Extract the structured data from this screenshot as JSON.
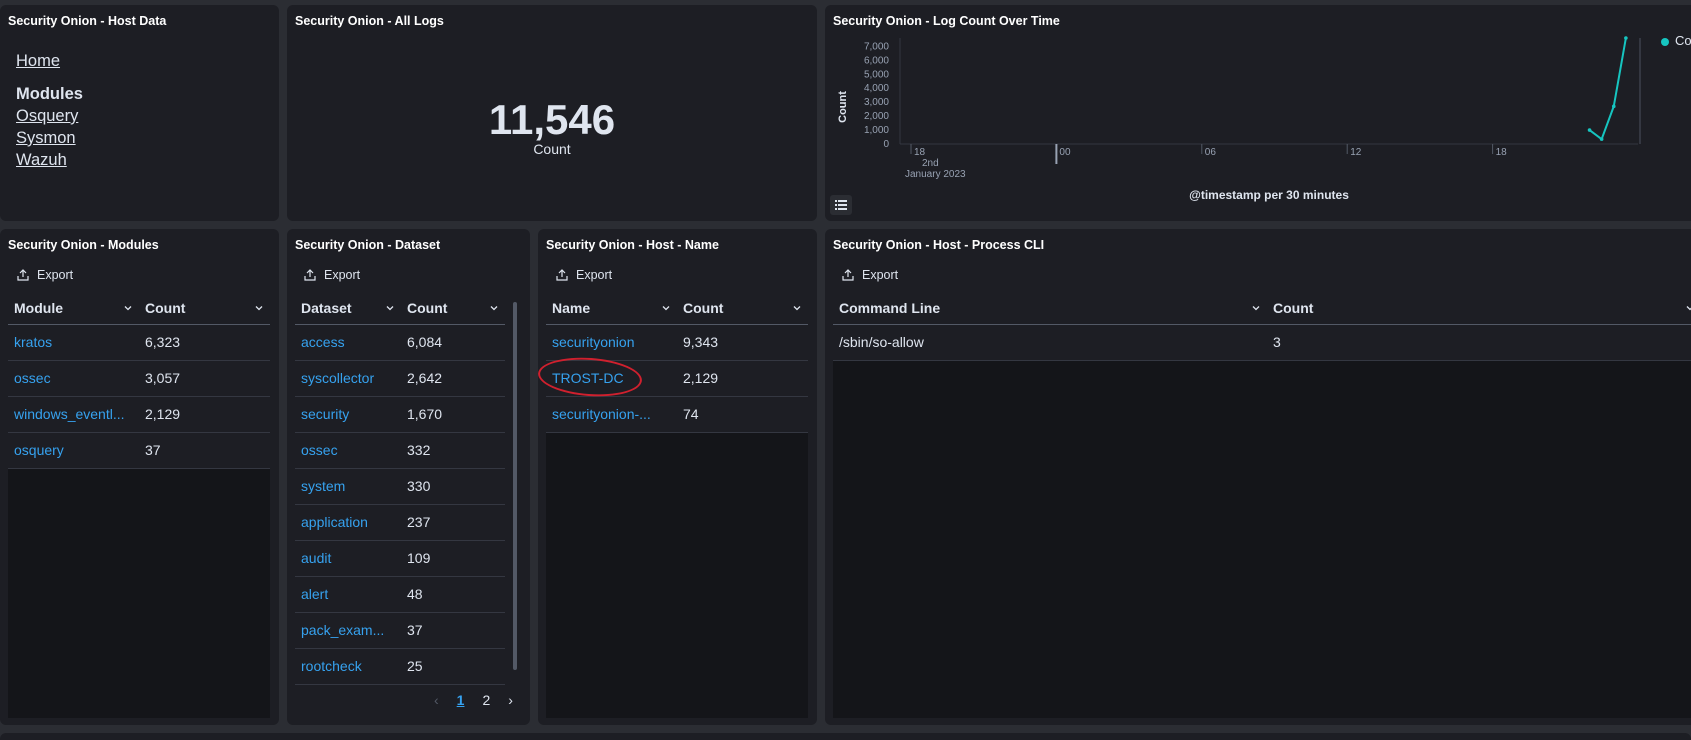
{
  "panels": {
    "host_data": {
      "title": "Security Onion - Host Data",
      "home": "Home",
      "modules_heading": "Modules",
      "links": [
        "Osquery",
        "Sysmon",
        "Wazuh"
      ]
    },
    "all_logs": {
      "title": "Security Onion - All Logs",
      "value": "11,546",
      "label": "Count"
    },
    "log_count": {
      "title": "Security Onion - Log Count Over Time",
      "legend": "Co",
      "ylabel": "Count",
      "xlabel": "@timestamp per 30 minutes",
      "x_sub1": "2nd",
      "x_sub2": "January 2023"
    },
    "modules": {
      "title": "Security Onion - Modules",
      "export": "Export",
      "headers": [
        "Module",
        "Count"
      ],
      "rows": [
        {
          "name": "kratos",
          "count": "6,323"
        },
        {
          "name": "ossec",
          "count": "3,057"
        },
        {
          "name": "windows_eventl...",
          "count": "2,129"
        },
        {
          "name": "osquery",
          "count": "37"
        }
      ]
    },
    "dataset": {
      "title": "Security Onion - Dataset",
      "export": "Export",
      "headers": [
        "Dataset",
        "Count"
      ],
      "rows": [
        {
          "name": "access",
          "count": "6,084"
        },
        {
          "name": "syscollector",
          "count": "2,642"
        },
        {
          "name": "security",
          "count": "1,670"
        },
        {
          "name": "ossec",
          "count": "332"
        },
        {
          "name": "system",
          "count": "330"
        },
        {
          "name": "application",
          "count": "237"
        },
        {
          "name": "audit",
          "count": "109"
        },
        {
          "name": "alert",
          "count": "48"
        },
        {
          "name": "pack_exam...",
          "count": "37"
        },
        {
          "name": "rootcheck",
          "count": "25"
        }
      ],
      "pages": [
        "1",
        "2"
      ]
    },
    "host_name": {
      "title": "Security Onion - Host - Name",
      "export": "Export",
      "headers": [
        "Name",
        "Count"
      ],
      "rows": [
        {
          "name": "securityonion",
          "count": "9,343"
        },
        {
          "name": "TROST-DC",
          "count": "2,129"
        },
        {
          "name": "securityonion-...",
          "count": "74"
        }
      ]
    },
    "process_cli": {
      "title": "Security Onion - Host - Process CLI",
      "export": "Export",
      "headers": [
        "Command Line",
        "Count"
      ],
      "rows": [
        {
          "name": "/sbin/so-allow",
          "count": "3"
        }
      ]
    }
  },
  "chart_data": {
    "type": "line",
    "series": [
      {
        "name": "Co",
        "color": "#16c5c0",
        "x": [
          "2023-01-02T22:00",
          "2023-01-02T22:30",
          "2023-01-02T23:00",
          "2023-01-02T23:30"
        ],
        "values": [
          1000,
          350,
          2700,
          7600
        ]
      }
    ],
    "ylabel": "Count",
    "xlabel": "@timestamp per 30 minutes",
    "y_ticks": [
      "0",
      "1,000",
      "2,000",
      "3,000",
      "4,000",
      "5,000",
      "6,000",
      "7,000"
    ],
    "x_ticks": [
      "18",
      "00",
      "06",
      "12",
      "18"
    ],
    "ylim": [
      0,
      7600
    ]
  }
}
